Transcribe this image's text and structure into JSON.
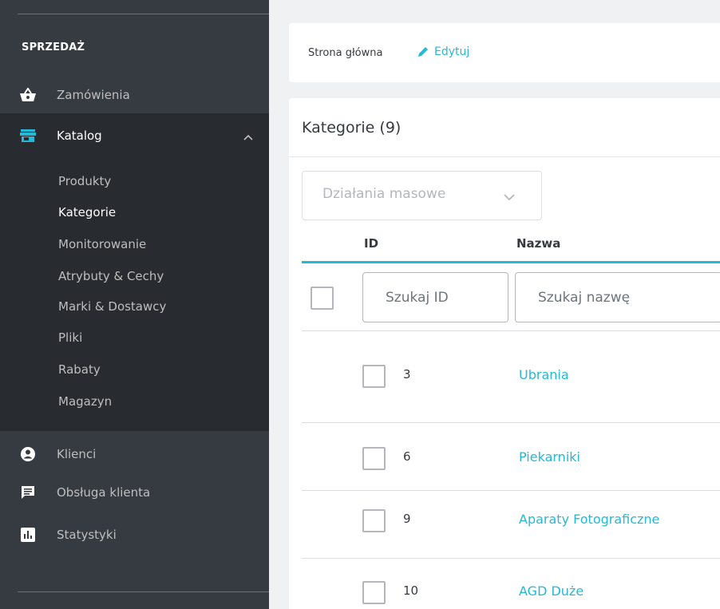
{
  "sidebar": {
    "section_title": "SPRZEDAŻ",
    "items": [
      {
        "label": "Zamówienia",
        "icon": "shopping-basket-icon"
      },
      {
        "label": "Katalog",
        "icon": "store-icon"
      },
      {
        "label": "Klienci",
        "icon": "account-circle-icon"
      },
      {
        "label": "Obsługa klienta",
        "icon": "chat-icon"
      },
      {
        "label": "Statystyki",
        "icon": "bar-chart-icon"
      }
    ],
    "catalog_submenu": [
      {
        "label": "Produkty"
      },
      {
        "label": "Kategorie"
      },
      {
        "label": "Monitorowanie"
      },
      {
        "label": "Atrybuty & Cechy"
      },
      {
        "label": "Marki & Dostawcy"
      },
      {
        "label": "Pliki"
      },
      {
        "label": "Rabaty"
      },
      {
        "label": "Magazyn"
      }
    ],
    "active_submenu": "Kategorie"
  },
  "breadcrumb": {
    "home": "Strona główna",
    "edit_label": "Edytuj"
  },
  "panel": {
    "title": "Kategorie (9)",
    "bulk_actions_label": "Działania masowe",
    "columns": {
      "id": "ID",
      "name": "Nazwa"
    },
    "filters": {
      "id_placeholder": "Szukaj ID",
      "name_placeholder": "Szukaj nazwę"
    },
    "rows": [
      {
        "id": "3",
        "name": "Ubrania"
      },
      {
        "id": "6",
        "name": "Piekarniki"
      },
      {
        "id": "9",
        "name": "Aparaty Fotograficzne"
      },
      {
        "id": "10",
        "name": "AGD Duże"
      }
    ]
  },
  "colors": {
    "sidebar_bg": "#363a41",
    "sidebar_active_bg": "#282b30",
    "accent": "#25b9d7",
    "page_bg": "#eff1f2"
  }
}
